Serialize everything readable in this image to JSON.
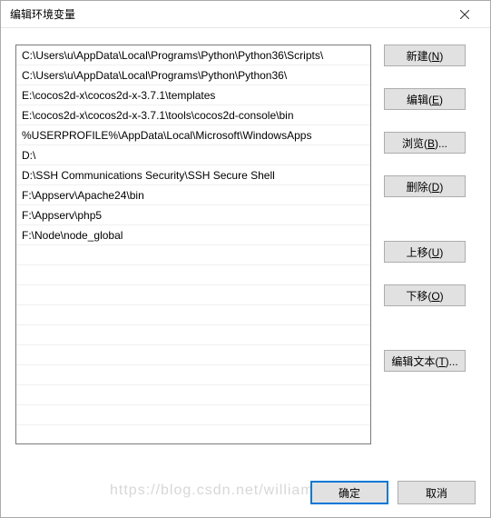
{
  "title": "编辑环境变量",
  "paths": [
    "C:\\Users\\u\\AppData\\Local\\Programs\\Python\\Python36\\Scripts\\",
    "C:\\Users\\u\\AppData\\Local\\Programs\\Python\\Python36\\",
    "E:\\cocos2d-x\\cocos2d-x-3.7.1\\templates",
    "E:\\cocos2d-x\\cocos2d-x-3.7.1\\tools\\cocos2d-console\\bin",
    "%USERPROFILE%\\AppData\\Local\\Microsoft\\WindowsApps",
    "D:\\",
    "D:\\SSH Communications Security\\SSH Secure Shell",
    "F:\\Appserv\\Apache24\\bin",
    "F:\\Appserv\\php5",
    "F:\\Node\\node_global"
  ],
  "buttons": {
    "new": "新建(N)",
    "edit": "编辑(E)",
    "browse": "浏览(B)...",
    "delete": "删除(D)",
    "moveup": "上移(U)",
    "movedown": "下移(O)",
    "edittext": "编辑文本(T)...",
    "ok": "确定",
    "cancel": "取消"
  },
  "watermark": "https://blog.csdn.net/william_munch"
}
